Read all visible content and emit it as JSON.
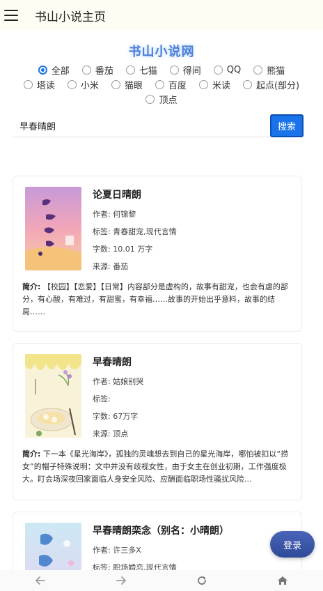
{
  "appbar": {
    "title": "书山小说主页",
    "menu_icon": "menu-icon"
  },
  "site_title": "书山小说网",
  "sources": {
    "row1": [
      "全部",
      "番茄",
      "七猫",
      "得间",
      "QQ",
      "熊猫"
    ],
    "row2": [
      "塔读",
      "小米",
      "猫眼",
      "百度",
      "米读",
      "起点(部分)"
    ],
    "row3": [
      "顶点"
    ],
    "selected": "全部"
  },
  "search": {
    "value": "早春晴朗",
    "button_label": "搜索"
  },
  "books": [
    {
      "title": "论夏日晴朗",
      "author": "作者: 何锦黎",
      "tags": "标签: 青春甜宠,现代言情",
      "words": "字数: 10.01 万字",
      "source": "来源: 番茄",
      "intro_label": "简介:",
      "intro_text": " 【校园】【恋爱】【日常】内容部分是虚构的，故事有甜宠，也会有虐的部分，有心酸，有难过，有甜蜜，有幸福……故事的开始出乎意料，故事的结局……"
    },
    {
      "title": "早春晴朗",
      "author": "作者: 姑娘别哭",
      "tags": "标签:",
      "words": "字数: 67万字",
      "source": "来源: 顶点",
      "intro_label": "简介:",
      "intro_text": " 下一本《星光海岸》，孤独的灵魂想去到自己的星光海岸，哪怕被扣以“捞女”的帽子特殊说明：文中并没有歧视女性，由于女主在创业初期，工作强度极大。盯会场深夜回家面临人身安全风险、应酬面临职场性骚扰风险..."
    },
    {
      "title": "早春晴朗栾念（别名：小晴朗）",
      "author": "作者: 许三多X",
      "tags": "标签: 职场婚恋,现代言情"
    }
  ],
  "login_label": "登录",
  "bottom_nav": [
    "arrow-left-icon",
    "arrow-right-icon",
    "refresh-icon",
    "home-icon"
  ],
  "colors": {
    "accent": "#1a73e8",
    "appbar_bg": "#fffdf3",
    "site_title": "#4a7fd8",
    "login_btn": "#3a54a8"
  }
}
